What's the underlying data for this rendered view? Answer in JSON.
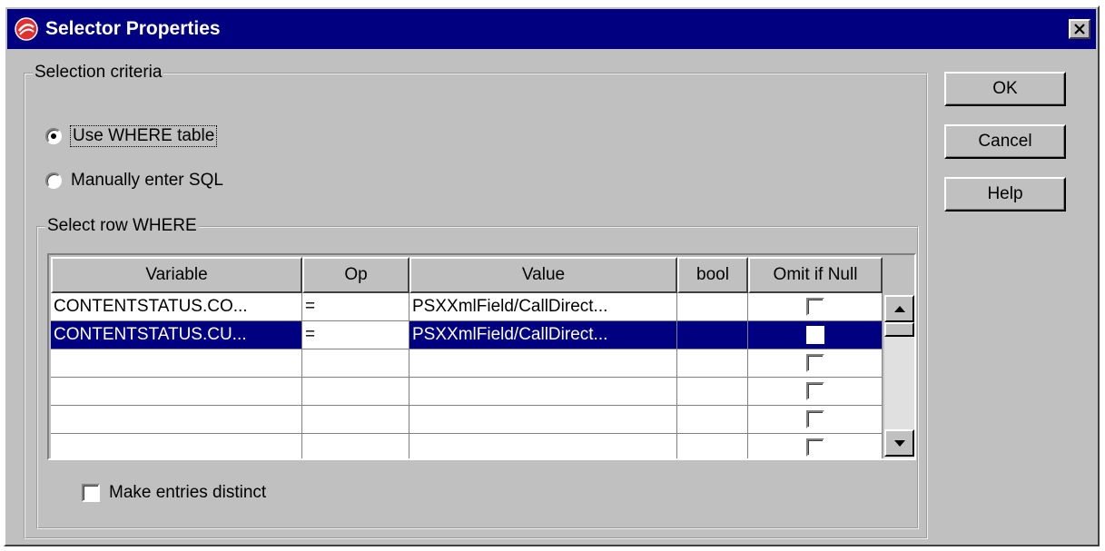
{
  "window": {
    "title": "Selector Properties",
    "close_label": "✕"
  },
  "criteria": {
    "group_title": "Selection criteria",
    "radio_where": "Use WHERE table",
    "radio_sql": "Manually enter SQL",
    "selected": "where"
  },
  "where_group": {
    "title": "Select row WHERE",
    "columns": [
      "Variable",
      "Op",
      "Value",
      "bool",
      "Omit if Null"
    ],
    "rows": [
      {
        "variable": "CONTENTSTATUS.CO...",
        "op": "=",
        "value": "PSXXmlField/CallDirect...",
        "bool": "",
        "omit_if_null": false,
        "selected": false
      },
      {
        "variable": "CONTENTSTATUS.CU...",
        "op": "=",
        "value": "PSXXmlField/CallDirect...",
        "bool": "",
        "omit_if_null": false,
        "selected": true
      },
      {
        "variable": "",
        "op": "",
        "value": "",
        "bool": "",
        "omit_if_null": false,
        "selected": false
      },
      {
        "variable": "",
        "op": "",
        "value": "",
        "bool": "",
        "omit_if_null": false,
        "selected": false
      },
      {
        "variable": "",
        "op": "",
        "value": "",
        "bool": "",
        "omit_if_null": false,
        "selected": false
      },
      {
        "variable": "",
        "op": "",
        "value": "",
        "bool": "",
        "omit_if_null": false,
        "selected": false
      }
    ],
    "distinct_label": "Make entries distinct",
    "distinct_checked": false
  },
  "buttons": {
    "ok": "OK",
    "cancel": "Cancel",
    "help": "Help"
  },
  "icons": {
    "app": "app-logo-icon",
    "close": "close-icon",
    "scroll_up": "arrow-up-icon",
    "scroll_down": "arrow-down-icon"
  },
  "colors": {
    "titlebar": "#000080",
    "face": "#c0c0c0",
    "selection": "#000080"
  }
}
